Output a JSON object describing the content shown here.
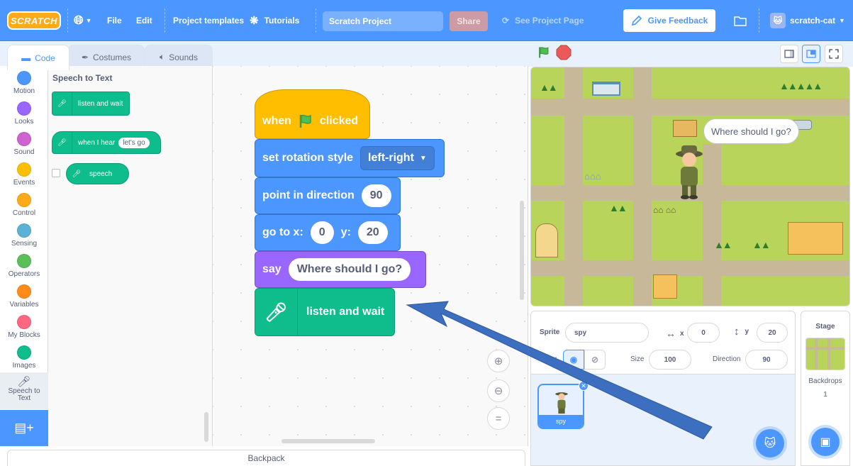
{
  "menubar": {
    "logo": "SCRATCH",
    "file": "File",
    "edit": "Edit",
    "project_templates": "Project templates",
    "tutorials": "Tutorials",
    "project_title": "Scratch Project",
    "share": "Share",
    "see_project_page": "See Project Page",
    "give_feedback": "Give Feedback",
    "username": "scratch-cat"
  },
  "tabs": {
    "code": "Code",
    "costumes": "Costumes",
    "sounds": "Sounds"
  },
  "categories": [
    {
      "label": "Motion",
      "color": "#4c97ff"
    },
    {
      "label": "Looks",
      "color": "#9966ff"
    },
    {
      "label": "Sound",
      "color": "#cf63cf"
    },
    {
      "label": "Events",
      "color": "#ffbf00"
    },
    {
      "label": "Control",
      "color": "#ffab19"
    },
    {
      "label": "Sensing",
      "color": "#5cb1d6"
    },
    {
      "label": "Operators",
      "color": "#59c059"
    },
    {
      "label": "Variables",
      "color": "#ff8c1a"
    },
    {
      "label": "My Blocks",
      "color": "#ff6680"
    },
    {
      "label": "Images",
      "color": "#0fbd8c"
    },
    {
      "label": "Speech to Text",
      "color": "#0fbd8c",
      "icon": "microphone-icon"
    }
  ],
  "palette": {
    "title": "Speech to Text",
    "listen_and_wait": "listen and wait",
    "when_i_hear": "when I hear",
    "when_i_hear_value": "let's go",
    "speech": "speech"
  },
  "script": {
    "when": "when",
    "clicked": "clicked",
    "set_rotation_style": "set rotation style",
    "rotation_value": "left-right",
    "point_in_direction": "point in direction",
    "direction_value": "90",
    "go_to_x": "go to x:",
    "x_value": "0",
    "y_label": "y:",
    "y_value": "20",
    "say": "say",
    "say_value": "Where should I go?",
    "listen_and_wait": "listen and wait"
  },
  "backpack": "Backpack",
  "stage": {
    "speech_bubble": "Where should I go?"
  },
  "sprite_info": {
    "sprite_label": "Sprite",
    "sprite_name": "spy",
    "x_label": "x",
    "x_value": "0",
    "y_label": "y",
    "y_value": "20",
    "show_label": "w",
    "size_label": "Size",
    "size_value": "100",
    "direction_label": "Direction",
    "direction_value": "90"
  },
  "sprite_list": {
    "thumb_name": "spy"
  },
  "stage_pane": {
    "title": "Stage",
    "backdrops_label": "Backdrops",
    "backdrops_count": "1"
  },
  "colors": {
    "menubar": "#4c97ff",
    "events": "#ffbf00",
    "motion": "#4c97ff",
    "looks": "#9966ff",
    "speech": "#0fbd8c",
    "annotation_arrow": "#3d6fc0"
  }
}
